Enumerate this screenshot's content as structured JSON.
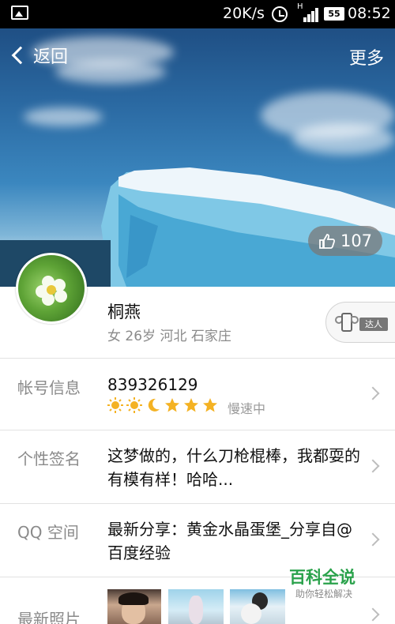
{
  "status_bar": {
    "speed": "20K/s",
    "signal_type": "H",
    "battery": "55",
    "time": "08:52"
  },
  "nav": {
    "back_label": "返回",
    "more_label": "更多"
  },
  "cover": {
    "like_count": "107"
  },
  "profile": {
    "name": "桐燕",
    "details": "女 26岁 河北 石家庄",
    "badge_label": "达人"
  },
  "rows": {
    "account": {
      "label": "帐号信息",
      "qq_number": "839326129",
      "level_icons": [
        "sun-icon",
        "sun-icon",
        "moon-icon",
        "star-icon",
        "star-icon",
        "star-icon"
      ],
      "speed_status": "慢速中"
    },
    "signature": {
      "label": "个性签名",
      "text": "这梦做的，什么刀枪棍棒，我都耍的有模有样！哈哈..."
    },
    "qzone": {
      "label": "QQ 空间",
      "text": "最新分享：黄金水晶蛋堡_分享自@百度经验"
    },
    "photos": {
      "label": "最新照片"
    }
  },
  "watermark": {
    "title": "百科全说",
    "subtitle": "助你轻松解决"
  },
  "colors": {
    "accent_green": "#2aa24b",
    "label_gray": "#8a8a8a",
    "level_gold": "#f4b223"
  }
}
